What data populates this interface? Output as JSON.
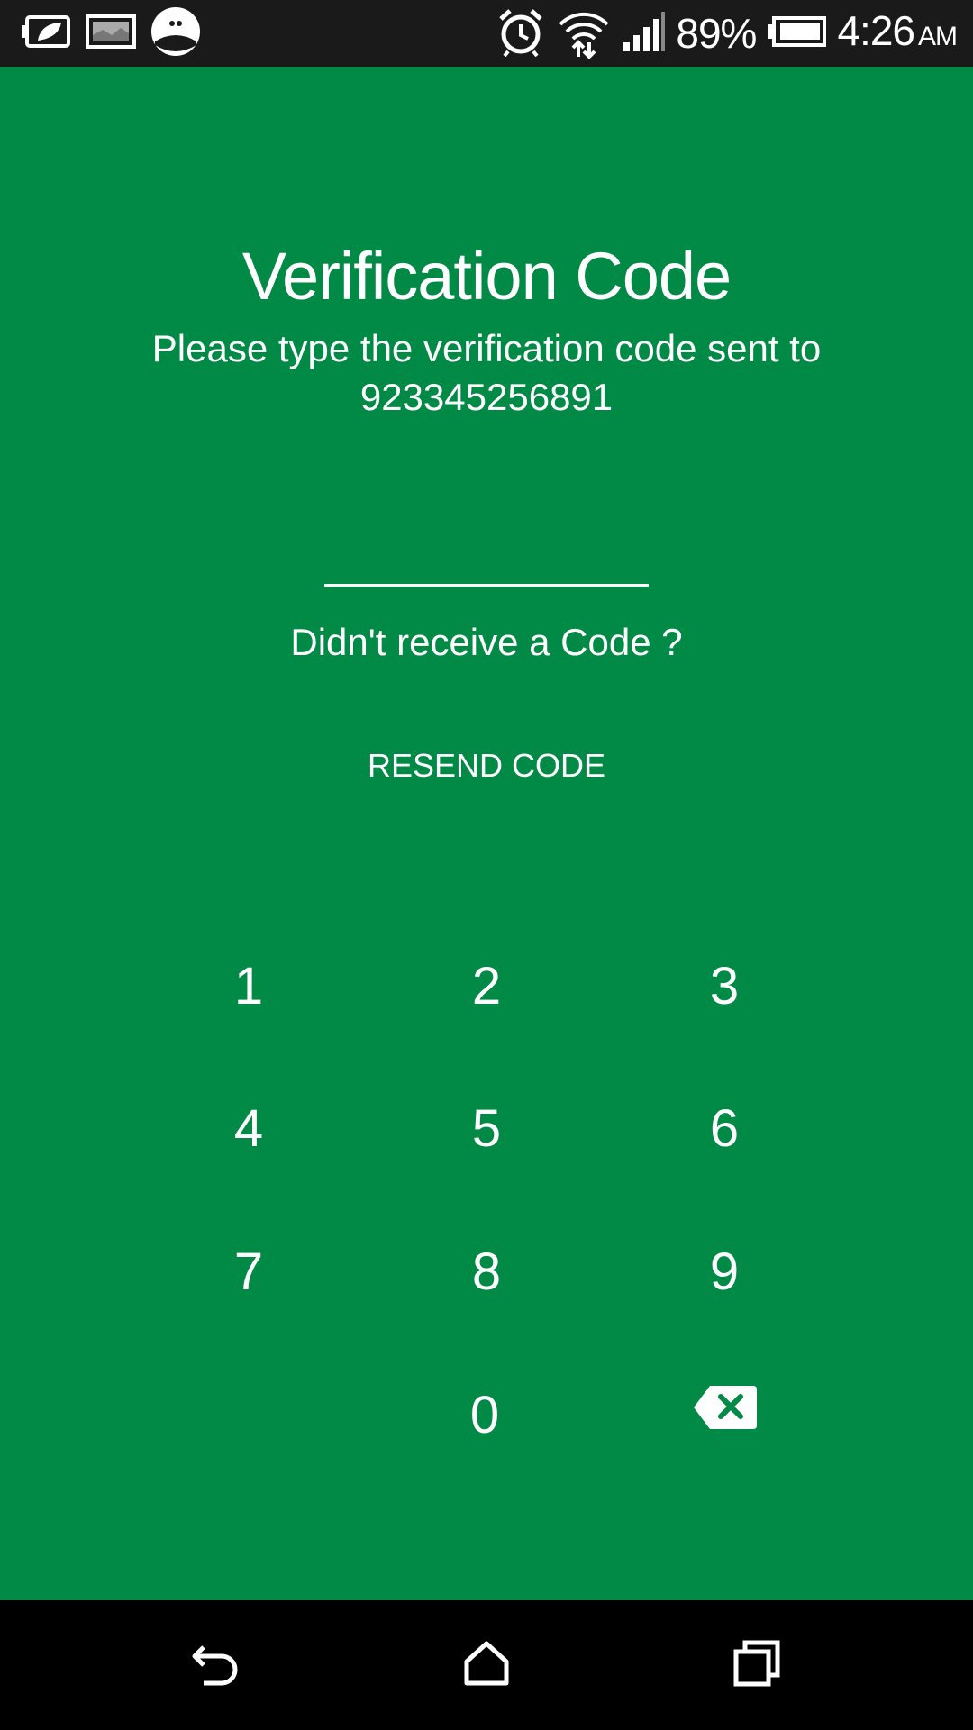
{
  "status_bar": {
    "battery_percent": "89%",
    "time": "4:26",
    "ampm": "AM",
    "left_icons": [
      "battery-saver-icon",
      "image-icon",
      "owl-app-icon"
    ],
    "right_icons": [
      "alarm-icon",
      "wifi-icon",
      "signal-icon",
      "battery-icon"
    ]
  },
  "screen": {
    "title": "Verification Code",
    "subtitle": "Please type the verification code sent to",
    "phone_number": "923345256891",
    "code_input": {
      "value": "",
      "placeholder": ""
    },
    "didnt_receive": "Didn't receive a Code ?",
    "resend_label": "RESEND CODE"
  },
  "keypad": {
    "keys": [
      "1",
      "2",
      "3",
      "4",
      "5",
      "6",
      "7",
      "8",
      "9",
      "",
      "0",
      "backspace-icon"
    ]
  },
  "nav_bar": {
    "buttons": [
      "back-icon",
      "home-icon",
      "recents-icon"
    ]
  },
  "colors": {
    "background": "#008A45",
    "status_bar": "#1a1a1a",
    "nav_bar": "#000000",
    "text": "#ffffff"
  }
}
